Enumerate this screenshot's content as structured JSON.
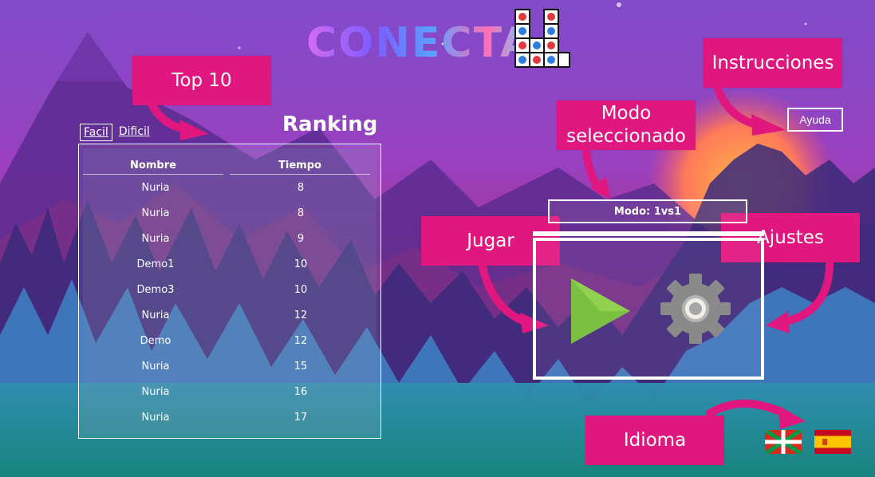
{
  "app": {
    "logo_text": "CONECTA",
    "logo_number": "4"
  },
  "callouts": {
    "top10": "Top 10",
    "instrucciones": "Instrucciones",
    "modo": "Modo seleccionado",
    "jugar": "Jugar",
    "ajustes": "Ajustes",
    "idioma": "Idioma"
  },
  "ranking": {
    "title": "Ranking",
    "tabs": [
      {
        "label": "Facil",
        "active": true
      },
      {
        "label": "Dificil",
        "active": false
      }
    ],
    "columns": [
      "Nombre",
      "Tiempo"
    ],
    "rows": [
      {
        "name": "Nuria",
        "time": "8"
      },
      {
        "name": "Nuria",
        "time": "8"
      },
      {
        "name": "Nuria",
        "time": "9"
      },
      {
        "name": "Demo1",
        "time": "10"
      },
      {
        "name": "Demo3",
        "time": "10"
      },
      {
        "name": "Nuria",
        "time": "12"
      },
      {
        "name": "Demo",
        "time": "12"
      },
      {
        "name": "Nuria",
        "time": "15"
      },
      {
        "name": "Nuria",
        "time": "16"
      },
      {
        "name": "Nuria",
        "time": "17"
      }
    ]
  },
  "help_button": "Ayuda",
  "mode_label": "Modo: 1vs1",
  "colors": {
    "callout": "#e0177e",
    "play": "#7bc043",
    "gear": "#8a8a8a"
  },
  "icons": [
    "play-icon",
    "gear-icon",
    "flag-basque-icon",
    "flag-spain-icon"
  ]
}
